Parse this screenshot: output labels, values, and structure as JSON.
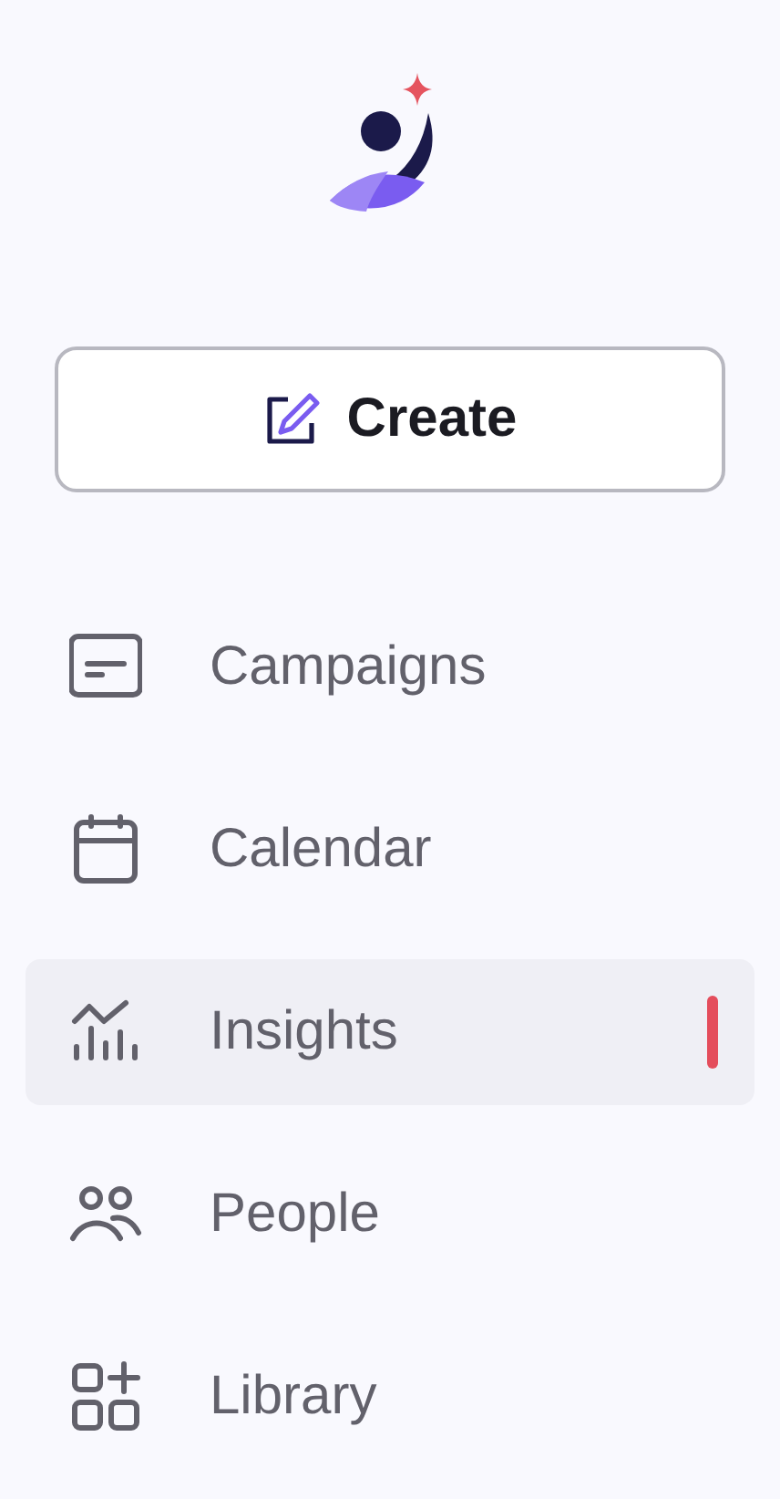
{
  "create_button": {
    "label": "Create"
  },
  "nav": [
    {
      "label": "Campaigns",
      "kind": "card",
      "selected": false
    },
    {
      "label": "Calendar",
      "kind": "calendar",
      "selected": false
    },
    {
      "label": "Insights",
      "kind": "chart",
      "selected": true
    },
    {
      "label": "People",
      "kind": "people",
      "selected": false
    },
    {
      "label": "Library",
      "kind": "grid",
      "selected": false
    }
  ]
}
